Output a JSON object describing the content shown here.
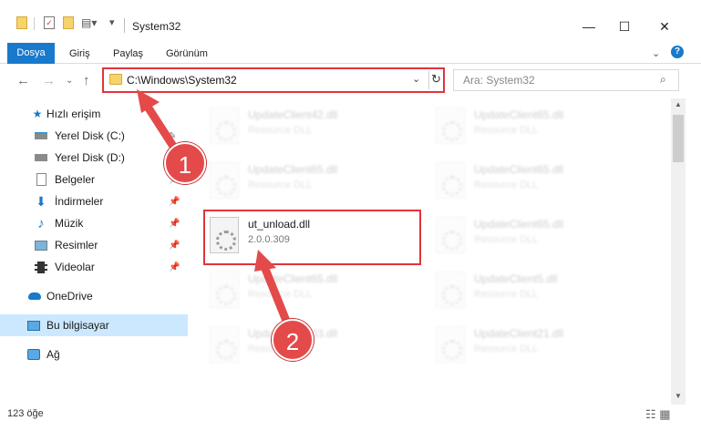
{
  "window": {
    "title": "System32",
    "controls": {
      "minimize": "—",
      "maximize": "☐",
      "close": "✕"
    }
  },
  "ribbon": {
    "tabs": [
      "Dosya",
      "Giriş",
      "Paylaş",
      "Görünüm"
    ],
    "help": "?"
  },
  "navigation": {
    "address": "C:\\Windows\\System32",
    "search_placeholder": "Ara: System32"
  },
  "sidebar": {
    "items": [
      {
        "label": "Hızlı erişim",
        "icon": "star-icon"
      },
      {
        "label": "Yerel Disk (C:)",
        "icon": "drive-icon"
      },
      {
        "label": "Yerel Disk (D:)",
        "icon": "drive-icon"
      },
      {
        "label": "Belgeler",
        "icon": "documents-icon"
      },
      {
        "label": "İndirmeler",
        "icon": "download-icon"
      },
      {
        "label": "Müzik",
        "icon": "music-icon"
      },
      {
        "label": "Resimler",
        "icon": "pictures-icon"
      },
      {
        "label": "Videolar",
        "icon": "videos-icon"
      },
      {
        "label": "OneDrive",
        "icon": "cloud-icon"
      },
      {
        "label": "Bu bilgisayar",
        "icon": "computer-icon"
      },
      {
        "label": "Ağ",
        "icon": "network-icon"
      }
    ]
  },
  "files": [
    {
      "name": "UpdateClient42.dll",
      "type": "Resource DLL"
    },
    {
      "name": "UpdateClient65.dll",
      "type": "Resource DLL"
    },
    {
      "name": "UpdateClient65.dll",
      "type": "Resource DLL"
    },
    {
      "name": "UpdateClient65.dll",
      "type": "Resource DLL"
    },
    {
      "name": "ut_unload.dll",
      "type": "2.0.0.309"
    },
    {
      "name": "UpdateClient65.dll",
      "type": "Resource DLL"
    },
    {
      "name": "UpdateClient65.dll",
      "type": "Resource DLL"
    },
    {
      "name": "UpdateClient5.dll",
      "type": "Resource DLL"
    },
    {
      "name": "UpdateClient63.dll",
      "type": "Resource DLL"
    },
    {
      "name": "UpdateClient21.dll",
      "type": "Resource DLL"
    }
  ],
  "status": {
    "item_count": "123 öğe"
  },
  "callouts": {
    "one": "1",
    "two": "2"
  },
  "colors": {
    "accent": "#1979ca",
    "highlight": "#e2343a",
    "callout": "#e44a4a"
  }
}
